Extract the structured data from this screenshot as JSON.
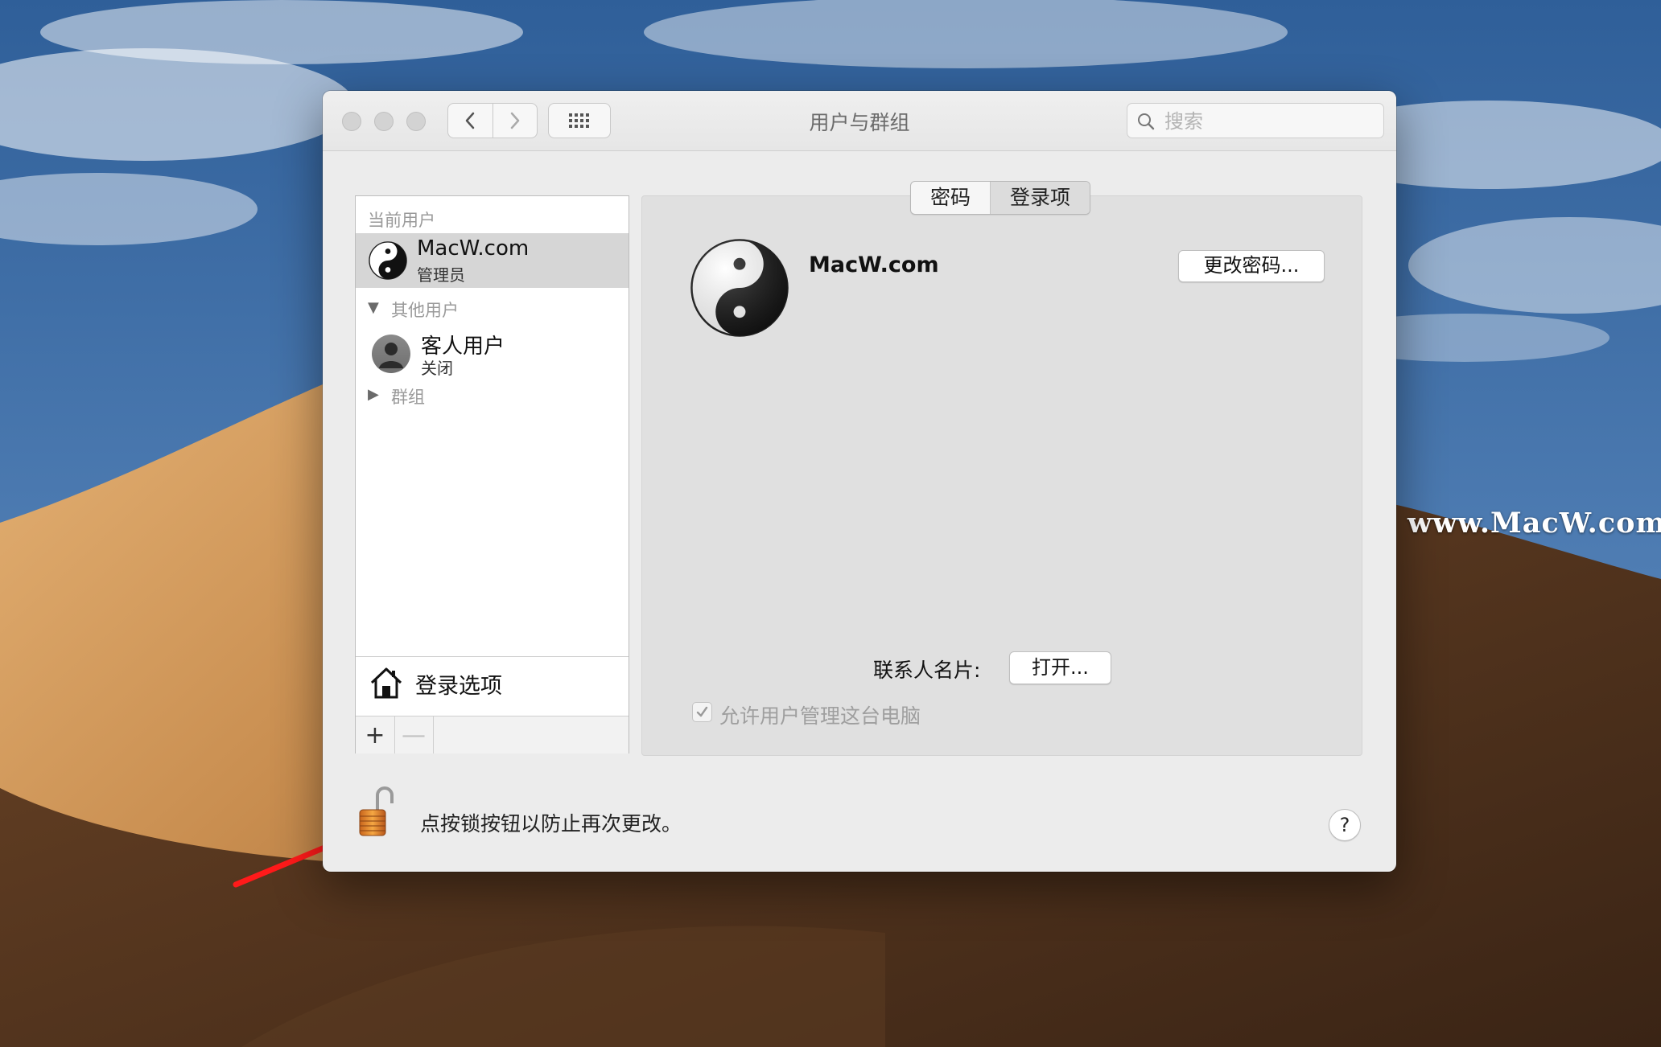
{
  "window": {
    "title": "用户与群组",
    "search_placeholder": "搜索"
  },
  "sidebar": {
    "current_users_header": "当前用户",
    "current_user": {
      "name": "MacW.com",
      "role": "管理员",
      "avatar": "yin-yang-icon"
    },
    "other_users_header": "其他用户",
    "guest_user": {
      "name": "客人用户",
      "status": "关闭",
      "avatar": "person-icon"
    },
    "groups_header": "群组",
    "login_options_label": "登录选项",
    "add_label": "+",
    "remove_label": "—"
  },
  "tabs": [
    {
      "label": "密码",
      "active": false
    },
    {
      "label": "登录项",
      "active": true
    }
  ],
  "profile": {
    "name": "MacW.com",
    "change_password_label": "更改密码...",
    "contact_card_label": "联系人名片:",
    "open_label": "打开...",
    "allow_admin_label": "允许用户管理这台电脑",
    "allow_admin_checked": true
  },
  "footer": {
    "lock_text": "点按锁按钮以防止再次更改。",
    "help_label": "?"
  },
  "watermark": {
    "text": "www.MacW.com"
  },
  "colors": {
    "sky": "#3f6aa0",
    "dune_light": "#d7a061",
    "dune_dark": "#4a2f1c",
    "selection": "#d6d6d6",
    "arrow": "#ff1a1a"
  }
}
